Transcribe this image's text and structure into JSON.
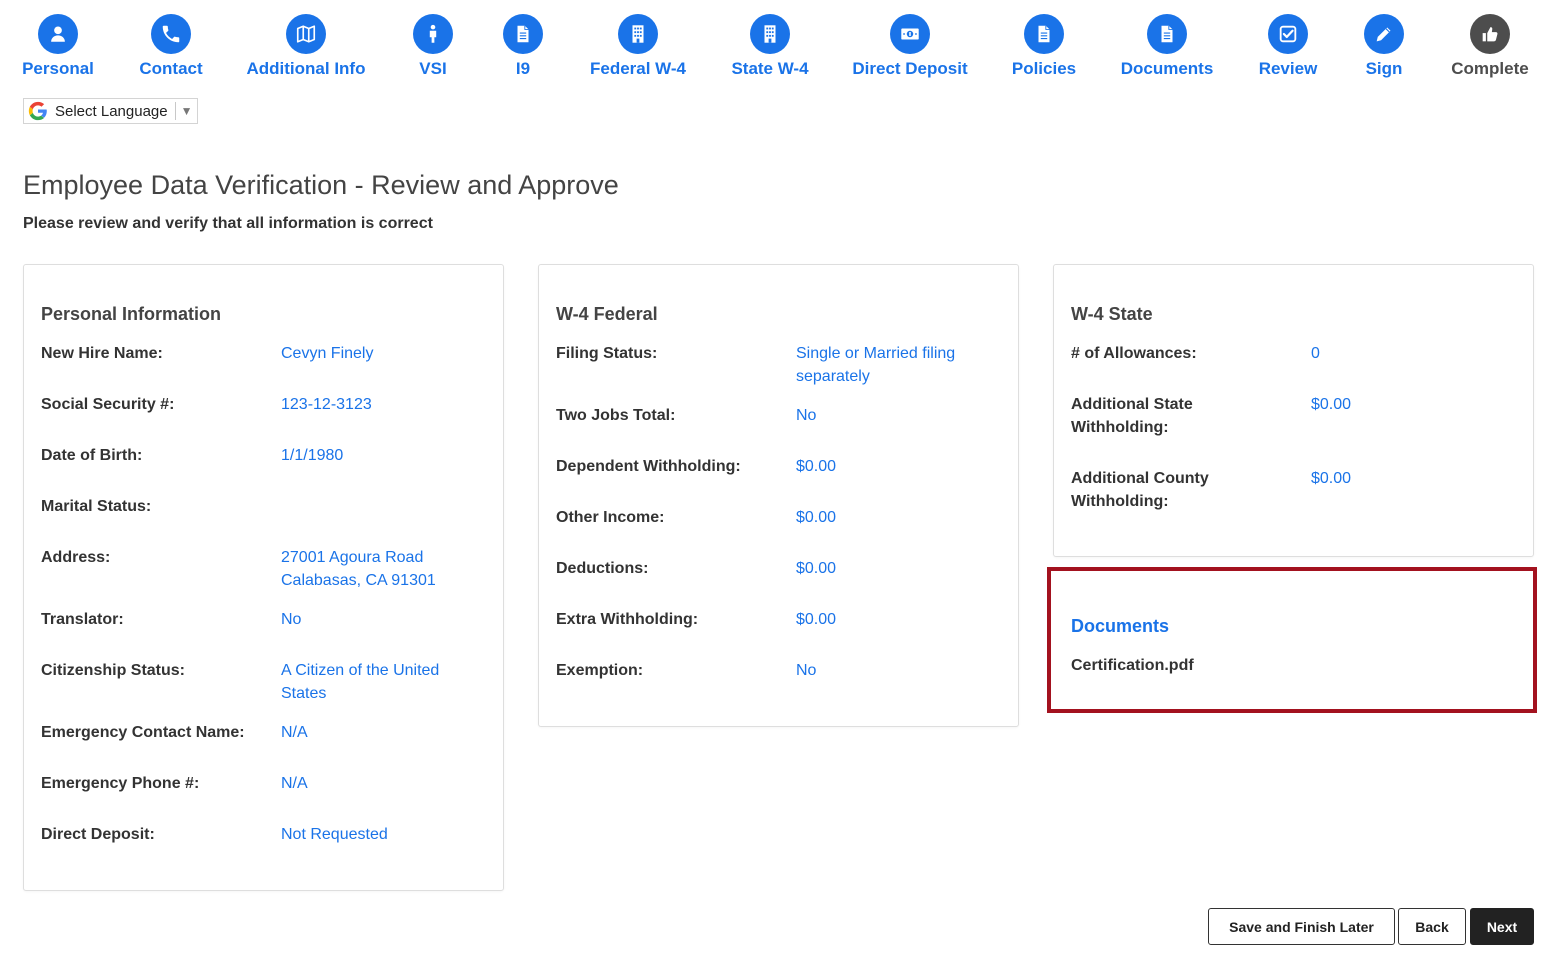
{
  "steps": [
    {
      "label": "Personal",
      "icon": "person-icon"
    },
    {
      "label": "Contact",
      "icon": "phone-icon"
    },
    {
      "label": "Additional Info",
      "icon": "map-icon"
    },
    {
      "label": "VSI",
      "icon": "standing-person-icon"
    },
    {
      "label": "I9",
      "icon": "document-icon"
    },
    {
      "label": "Federal W-4",
      "icon": "building-icon"
    },
    {
      "label": "State W-4",
      "icon": "building-icon"
    },
    {
      "label": "Direct Deposit",
      "icon": "money-icon"
    },
    {
      "label": "Policies",
      "icon": "document-icon"
    },
    {
      "label": "Documents",
      "icon": "document-icon"
    },
    {
      "label": "Review",
      "icon": "checkbox-icon"
    },
    {
      "label": "Sign",
      "icon": "pencil-icon"
    },
    {
      "label": "Complete",
      "icon": "thumbs-up-icon"
    }
  ],
  "language": {
    "label": "Select Language",
    "arrow": "▼"
  },
  "page": {
    "title": "Employee Data Verification - Review and Approve",
    "subtitle": "Please review and verify that all information is correct"
  },
  "personal": {
    "title": "Personal Information",
    "rows": [
      {
        "label": "New Hire Name:",
        "value": "Cevyn Finely"
      },
      {
        "label": "Social Security #:",
        "value": "123-12-3123"
      },
      {
        "label": "Date of Birth:",
        "value": "1/1/1980"
      },
      {
        "label": "Marital Status:",
        "value": ""
      },
      {
        "label": "Address:",
        "value": "27001 Agoura Road Calabasas, CA 91301"
      },
      {
        "label": "Translator:",
        "value": "No"
      },
      {
        "label": "Citizenship Status:",
        "value": "A Citizen of the United States"
      },
      {
        "label": "Emergency Contact Name:",
        "value": "N/A"
      },
      {
        "label": "Emergency Phone #:",
        "value": "N/A"
      },
      {
        "label": "Direct Deposit:",
        "value": "Not Requested"
      }
    ]
  },
  "w4_federal": {
    "title": "W-4 Federal",
    "rows": [
      {
        "label": "Filing Status:",
        "value": "Single or Married filing separately"
      },
      {
        "label": "Two Jobs Total:",
        "value": "No"
      },
      {
        "label": "Dependent Withholding:",
        "value": "$0.00"
      },
      {
        "label": "Other Income:",
        "value": "$0.00"
      },
      {
        "label": "Deductions:",
        "value": "$0.00"
      },
      {
        "label": "Extra Withholding:",
        "value": "$0.00"
      },
      {
        "label": "Exemption:",
        "value": "No"
      }
    ]
  },
  "w4_state": {
    "title": "W-4 State",
    "rows": [
      {
        "label": "# of Allowances:",
        "value": "0"
      },
      {
        "label": "Additional State Withholding:",
        "value": "$0.00"
      },
      {
        "label": "Additional County Withholding:",
        "value": "$0.00"
      }
    ]
  },
  "documents": {
    "title": "Documents",
    "file": "Certification.pdf"
  },
  "buttons": {
    "save": "Save and Finish Later",
    "back": "Back",
    "next": "Next"
  },
  "colors": {
    "primary": "#1a73e8",
    "complete": "#4d4d4d",
    "highlight": "#a3121f",
    "button_dark": "#222222"
  }
}
